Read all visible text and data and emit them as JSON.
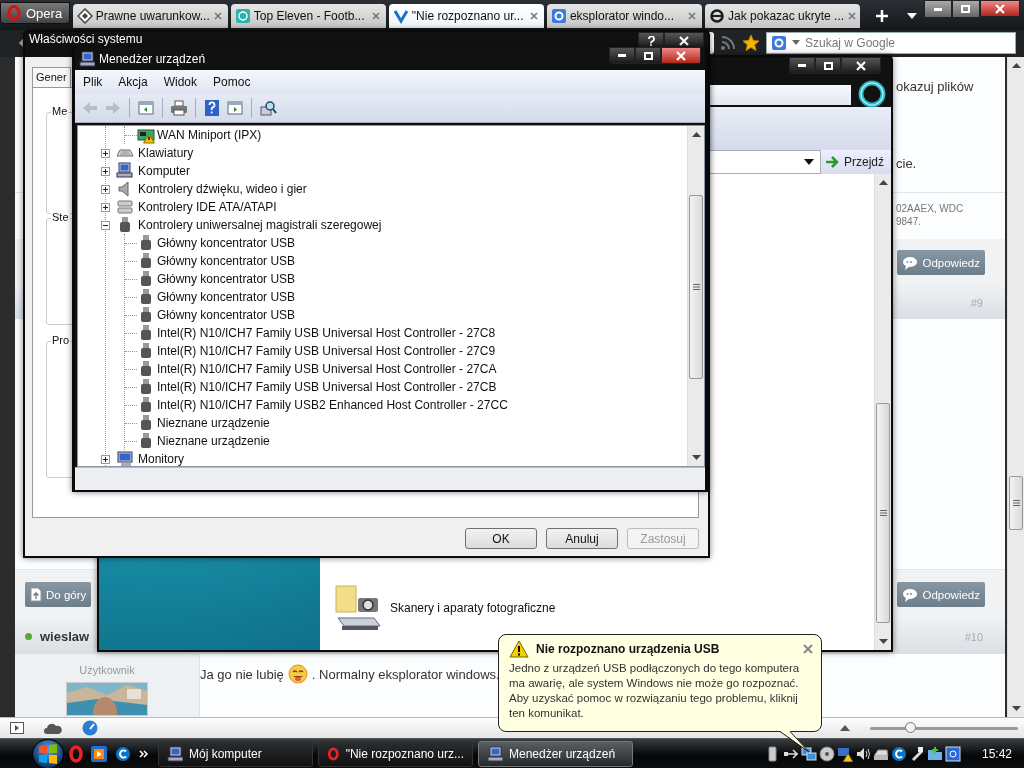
{
  "browser": {
    "menu_button": "Opera",
    "tabs": [
      {
        "title": "Prawne uwarunkow...",
        "selected": false
      },
      {
        "title": "Top Eleven - Footb...",
        "selected": false
      },
      {
        "title": "\"Nie rozpoznano ur...",
        "selected": true
      },
      {
        "title": "eksplorator windo...",
        "selected": false
      },
      {
        "title": "Jak pokazac ukryte ...",
        "selected": false
      }
    ],
    "search": {
      "placeholder": "Szukaj w Google"
    },
    "page": {
      "post_text_lines": [
        "okazuj plików",
        "cie."
      ],
      "signature_lines": [
        "02AAEX, WDC",
        "9847."
      ],
      "reply_buttons": [
        "Odpowiedz",
        "Odpowiedz"
      ],
      "post_numbers": [
        "#9",
        "#10"
      ],
      "top_button": "Do góry",
      "author": {
        "name": "wieslaw",
        "online": true
      },
      "user_role": "Użytkownik",
      "avatar": {
        "kind": "picture"
      },
      "message": {
        "before": "Ja go nie lubię",
        "after": ". Normalny eksplorator windows."
      }
    },
    "zoom_slider": {
      "level": 0.27
    }
  },
  "explorer": {
    "go_button": "Przejdź",
    "item_label": "Skanery i aparaty fotograficzne"
  },
  "system_properties": {
    "title": "Właściwości systemu",
    "tab": "Gener",
    "groups": [
      "Me",
      "Ste",
      "Pro"
    ],
    "buttons": [
      {
        "label": "OK",
        "disabled": false
      },
      {
        "label": "Anuluj",
        "disabled": false
      },
      {
        "label": "Zastosuj",
        "disabled": true
      }
    ]
  },
  "device_manager": {
    "title": "Menedżer urządzeń",
    "menu": [
      "Plik",
      "Akcja",
      "Widok",
      "Pomoc"
    ],
    "nav_buttons": [
      {
        "disabled": true
      },
      {
        "disabled": true
      }
    ],
    "tree": [
      {
        "kind": "device",
        "label": "WAN Miniport (IPX)",
        "warning": true
      },
      {
        "kind": "category",
        "label": "Klawiatury",
        "expanded": false
      },
      {
        "kind": "category",
        "label": "Komputer",
        "expanded": false
      },
      {
        "kind": "category",
        "label": "Kontrolery dźwięku, wideo i gier",
        "expanded": false
      },
      {
        "kind": "category",
        "label": "Kontrolery IDE ATA/ATAPI",
        "expanded": false
      },
      {
        "kind": "category",
        "label": "Kontrolery uniwersalnej magistrali szeregowej",
        "expanded": true,
        "children": [
          {
            "kind": "device",
            "label": "Główny koncentrator USB",
            "warning": false
          },
          {
            "kind": "device",
            "label": "Główny koncentrator USB",
            "warning": false
          },
          {
            "kind": "device",
            "label": "Główny koncentrator USB",
            "warning": false
          },
          {
            "kind": "device",
            "label": "Główny koncentrator USB",
            "warning": false
          },
          {
            "kind": "device",
            "label": "Główny koncentrator USB",
            "warning": false
          },
          {
            "kind": "device",
            "label": "Intel(R) N10/ICH7 Family USB Universal Host Controller - 27C8",
            "warning": false
          },
          {
            "kind": "device",
            "label": "Intel(R) N10/ICH7 Family USB Universal Host Controller - 27C9",
            "warning": false
          },
          {
            "kind": "device",
            "label": "Intel(R) N10/ICH7 Family USB Universal Host Controller - 27CA",
            "warning": false
          },
          {
            "kind": "device",
            "label": "Intel(R) N10/ICH7 Family USB Universal Host Controller - 27CB",
            "warning": false
          },
          {
            "kind": "device",
            "label": "Intel(R) N10/ICH7 Family USB2 Enhanced Host Controller - 27CC",
            "warning": false
          },
          {
            "kind": "device",
            "label": "Nieznane urządzenie",
            "warning": false
          },
          {
            "kind": "device",
            "label": "Nieznane urządzenie",
            "warning": false
          }
        ]
      },
      {
        "kind": "category",
        "label": "Monitory",
        "expanded": false
      }
    ]
  },
  "balloon": {
    "title": "Nie rozpoznano urządzenia USB",
    "text": "Jedno z urządzeń USB podłączonych do tego komputera ma awarię, ale system Windows nie może go rozpoznać. Aby uzyskać pomoc w rozwiązaniu tego problemu, kliknij ten komunikat."
  },
  "taskbar": {
    "buttons": [
      {
        "label": "Mój komputer",
        "selected": false
      },
      {
        "label": "\"Nie rozpoznano urz...",
        "selected": false
      },
      {
        "label": "Menedżer urządzeń",
        "selected": true
      }
    ],
    "clock": "15:42"
  }
}
